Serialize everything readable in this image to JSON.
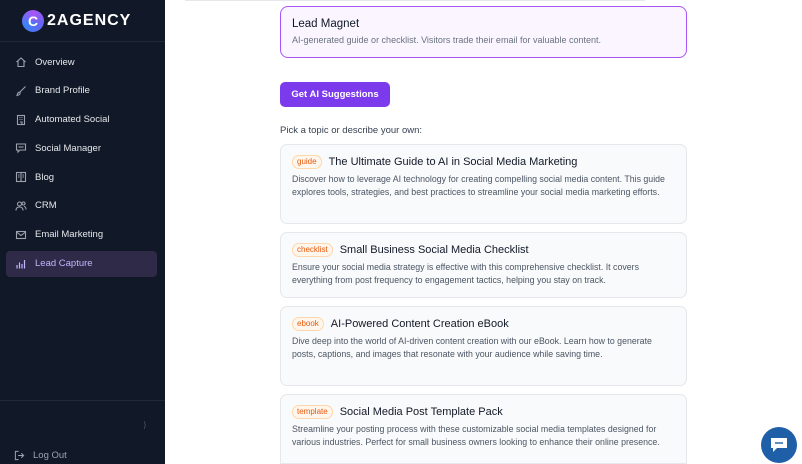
{
  "brand": {
    "logo_letter": "C",
    "name": "2AGENCY"
  },
  "sidebar": {
    "items": [
      {
        "label": "Overview",
        "icon": "home-icon"
      },
      {
        "label": "Brand Profile",
        "icon": "brush-icon"
      },
      {
        "label": "Automated Social",
        "icon": "building-icon"
      },
      {
        "label": "Social Manager",
        "icon": "chat-icon"
      },
      {
        "label": "Blog",
        "icon": "book-icon"
      },
      {
        "label": "CRM",
        "icon": "users-icon"
      },
      {
        "label": "Email Marketing",
        "icon": "mail-icon"
      },
      {
        "label": "Lead Capture",
        "icon": "bar-chart-icon",
        "active": true
      }
    ],
    "collapse_glyph": "⟩",
    "logout_label": "Log Out"
  },
  "main": {
    "selected_type": {
      "title": "Lead Magnet",
      "description": "AI-generated guide or checklist. Visitors trade their email for valuable content."
    },
    "ai_button_label": "Get AI Suggestions",
    "pick_label": "Pick a topic or describe your own:",
    "suggestions": [
      {
        "tag": "guide",
        "title": "The Ultimate Guide to AI in Social Media Marketing",
        "description": "Discover how to leverage AI technology for creating compelling social media content. This guide explores tools, strategies, and best practices to streamline your social media marketing efforts."
      },
      {
        "tag": "checklist",
        "title": "Small Business Social Media Checklist",
        "description": "Ensure your social media strategy is effective with this comprehensive checklist. It covers everything from post frequency to engagement tactics, helping you stay on track."
      },
      {
        "tag": "ebook",
        "title": "AI-Powered Content Creation eBook",
        "description": "Dive deep into the world of AI-driven content creation with our eBook. Learn how to generate posts, captions, and images that resonate with your audience while saving time."
      },
      {
        "tag": "template",
        "title": "Social Media Post Template Pack",
        "description": "Streamline your posting process with these customizable social media templates designed for various industries. Perfect for small business owners looking to enhance their online presence."
      }
    ]
  },
  "colors": {
    "accent": "#7c3aed",
    "sidebar_bg": "#111827",
    "tag": "#ea580c",
    "chat_bubble": "#1e5fa8"
  }
}
